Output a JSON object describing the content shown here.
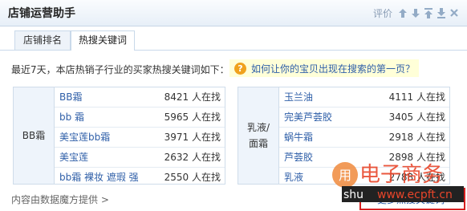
{
  "header": {
    "title": "店铺运营助手",
    "rate_label": "评价"
  },
  "tabs": [
    {
      "label": "店铺排名"
    },
    {
      "label": "热搜关键词"
    }
  ],
  "intro_text": "最近7天，本店热销子行业的买家热搜关键词如下：",
  "question_link": "如何让你的宝贝出现在搜索的第一页？",
  "tables": [
    {
      "category": "BB霜",
      "rows": [
        {
          "keyword": "BB霜",
          "count": "8421 人在找"
        },
        {
          "keyword": "bb 霜",
          "count": "5965 人在找"
        },
        {
          "keyword": "美宝莲bb霜",
          "count": "3971 人在找"
        },
        {
          "keyword": "美宝莲",
          "count": "2632 人在找"
        },
        {
          "keyword": "bb霜 裸妆 遮瑕 强",
          "count": "2550 人在找"
        }
      ]
    },
    {
      "category": "乳液/面霜",
      "category_line1": "乳液/",
      "category_line2": "面霜",
      "rows": [
        {
          "keyword": "玉兰油",
          "count": "4111 人在找"
        },
        {
          "keyword": "完美芦荟胶",
          "count": "3405 人在找"
        },
        {
          "keyword": "蜗牛霜",
          "count": "2918 人在找"
        },
        {
          "keyword": "芦荟胶",
          "count": "2898 人在找"
        },
        {
          "keyword": "乳液",
          "count": "2788 人在找"
        }
      ]
    }
  ],
  "footer": {
    "source": "内容由数据魔方提供 >",
    "more": "更多热搜关键词"
  },
  "watermark": {
    "text1": "电子商务",
    "text2": "shu",
    "text3": "www.ecpft.cn"
  },
  "colors": {
    "accent_link": "#2f5fa8",
    "highlight": "#ffffd8",
    "red_frame": "#d82020"
  }
}
